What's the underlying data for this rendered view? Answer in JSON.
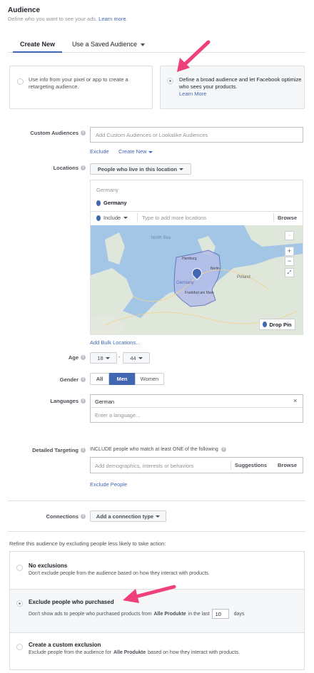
{
  "header": {
    "title": "Audience",
    "subtitle": "Define who you want to see your ads.",
    "learn_more": "Learn more."
  },
  "tabs": {
    "create_new": "Create New",
    "saved": "Use a Saved Audience"
  },
  "option_cards": {
    "retargeting": "Use info from your pixel or app to create a retargeting audience.",
    "broad": "Define a broad audience and let Facebook optimize who sees your products.",
    "broad_link": "Learn More"
  },
  "custom_audiences": {
    "label": "Custom Audiences",
    "placeholder": "Add Custom Audiences or Lookalike Audiences",
    "exclude": "Exclude",
    "create_new": "Create New"
  },
  "locations": {
    "label": "Locations",
    "dropdown": "People who live in this location",
    "group_header": "Germany",
    "selected": "Germany",
    "include": "Include",
    "search_placeholder": "Type to add more locations",
    "browse": "Browse",
    "drop_pin": "Drop Pin",
    "add_bulk": "Add Bulk Locations...",
    "map_labels": [
      "North Sea",
      "Germany",
      "Frankfurt am Main",
      "Poland",
      "Berlin",
      "Hamburg"
    ]
  },
  "age": {
    "label": "Age",
    "min": "18",
    "separator": "-",
    "max": "44"
  },
  "gender": {
    "label": "Gender",
    "options": [
      "All",
      "Men",
      "Women"
    ],
    "selected": "Men"
  },
  "languages": {
    "label": "Languages",
    "selected": "German",
    "placeholder": "Enter a language..."
  },
  "detailed_targeting": {
    "label": "Detailed Targeting",
    "include_text": "INCLUDE people who match at least ONE of the following",
    "placeholder": "Add demographics, interests or behaviors",
    "suggestions": "Suggestions",
    "browse": "Browse",
    "exclude_people": "Exclude People"
  },
  "connections": {
    "label": "Connections",
    "dropdown": "Add a connection type"
  },
  "refine": {
    "text": "Refine this audience by excluding people less likely to take action:",
    "options": [
      {
        "title": "No exclusions",
        "desc": "Don't exclude people from the audience based on how they interact with products."
      },
      {
        "title": "Exclude people who purchased",
        "desc_before": "Don't show ads to people who purchased products from",
        "desc_bold": "Alle Produkte",
        "desc_after": "in the last",
        "days_value": "10",
        "days_unit": "days"
      },
      {
        "title": "Create a custom exclusion",
        "desc_before": "Exclude people from the audience for",
        "desc_bold": "Alle Produkte",
        "desc_after": "based on how they interact with products."
      }
    ]
  },
  "colors": {
    "accent": "#4267b2",
    "arrow": "#f0407a"
  }
}
